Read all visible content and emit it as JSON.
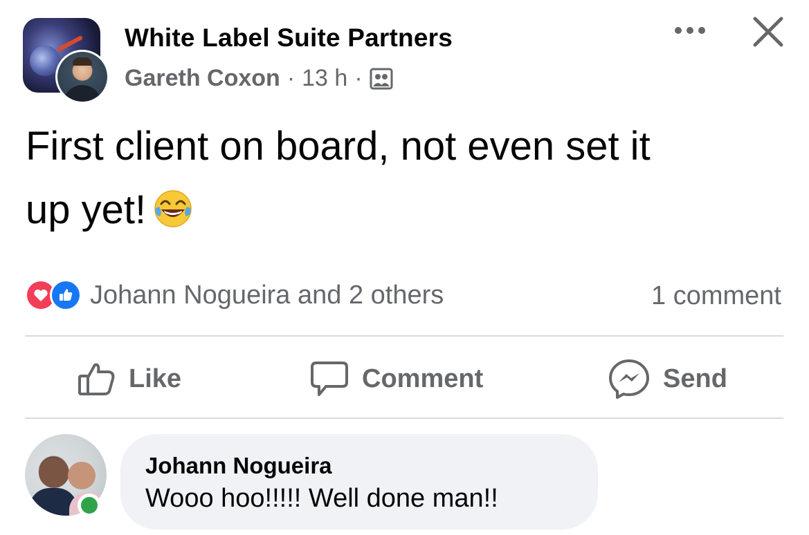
{
  "post": {
    "group_name": "White Label Suite Partners",
    "author": "Gareth Coxon",
    "separator1": "·",
    "timestamp": "13 h",
    "separator2": "·",
    "privacy_icon": "group-members-icon",
    "text_line1": "First client on board, not even set it",
    "text_line2": "up yet!",
    "emoji": "face-with-tears-of-joy"
  },
  "reactions": {
    "types": [
      "love",
      "like"
    ],
    "summary": "Johann Nogueira and 2 others",
    "comment_count": "1 comment"
  },
  "actions": {
    "like_label": "Like",
    "comment_label": "Comment",
    "send_label": "Send"
  },
  "comments": [
    {
      "author": "Johann Nogueira",
      "text": "Wooo hoo!!!!! Well done man!!",
      "online": true
    }
  ],
  "colors": {
    "secondary_text": "#65676b",
    "like_blue": "#1877f2",
    "love_red": "#f33e58",
    "online_green": "#31a24c",
    "bubble_bg": "#f0f2f5"
  }
}
